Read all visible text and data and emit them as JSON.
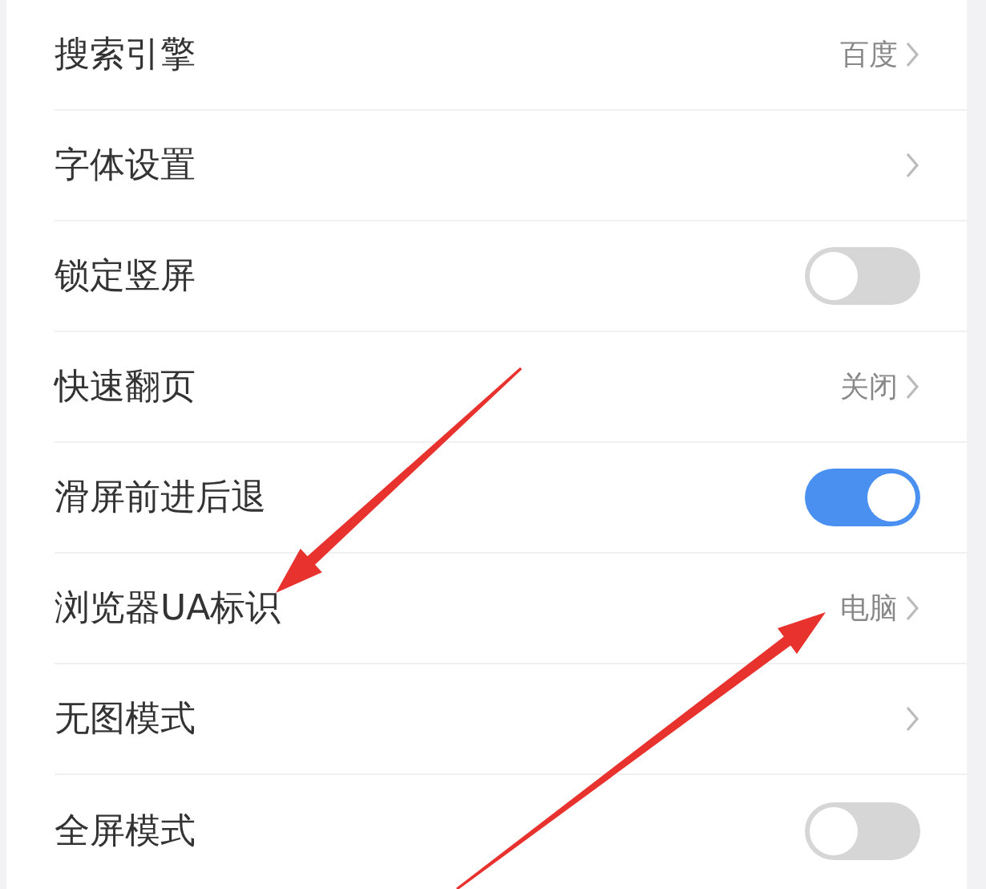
{
  "settings": [
    {
      "kind": "link",
      "label": "搜索引擎",
      "value": "百度"
    },
    {
      "kind": "link",
      "label": "字体设置"
    },
    {
      "kind": "switch",
      "label": "锁定竖屏",
      "on": false
    },
    {
      "kind": "link",
      "label": "快速翻页",
      "value": "关闭"
    },
    {
      "kind": "switch",
      "label": "滑屏前进后退",
      "on": true
    },
    {
      "kind": "link",
      "label": "浏览器UA标识",
      "value": "电脑",
      "arrow_to_label": true,
      "arrow_to_value": true
    },
    {
      "kind": "link",
      "label": "无图模式"
    },
    {
      "kind": "switch",
      "label": "全屏模式",
      "on": false
    }
  ]
}
